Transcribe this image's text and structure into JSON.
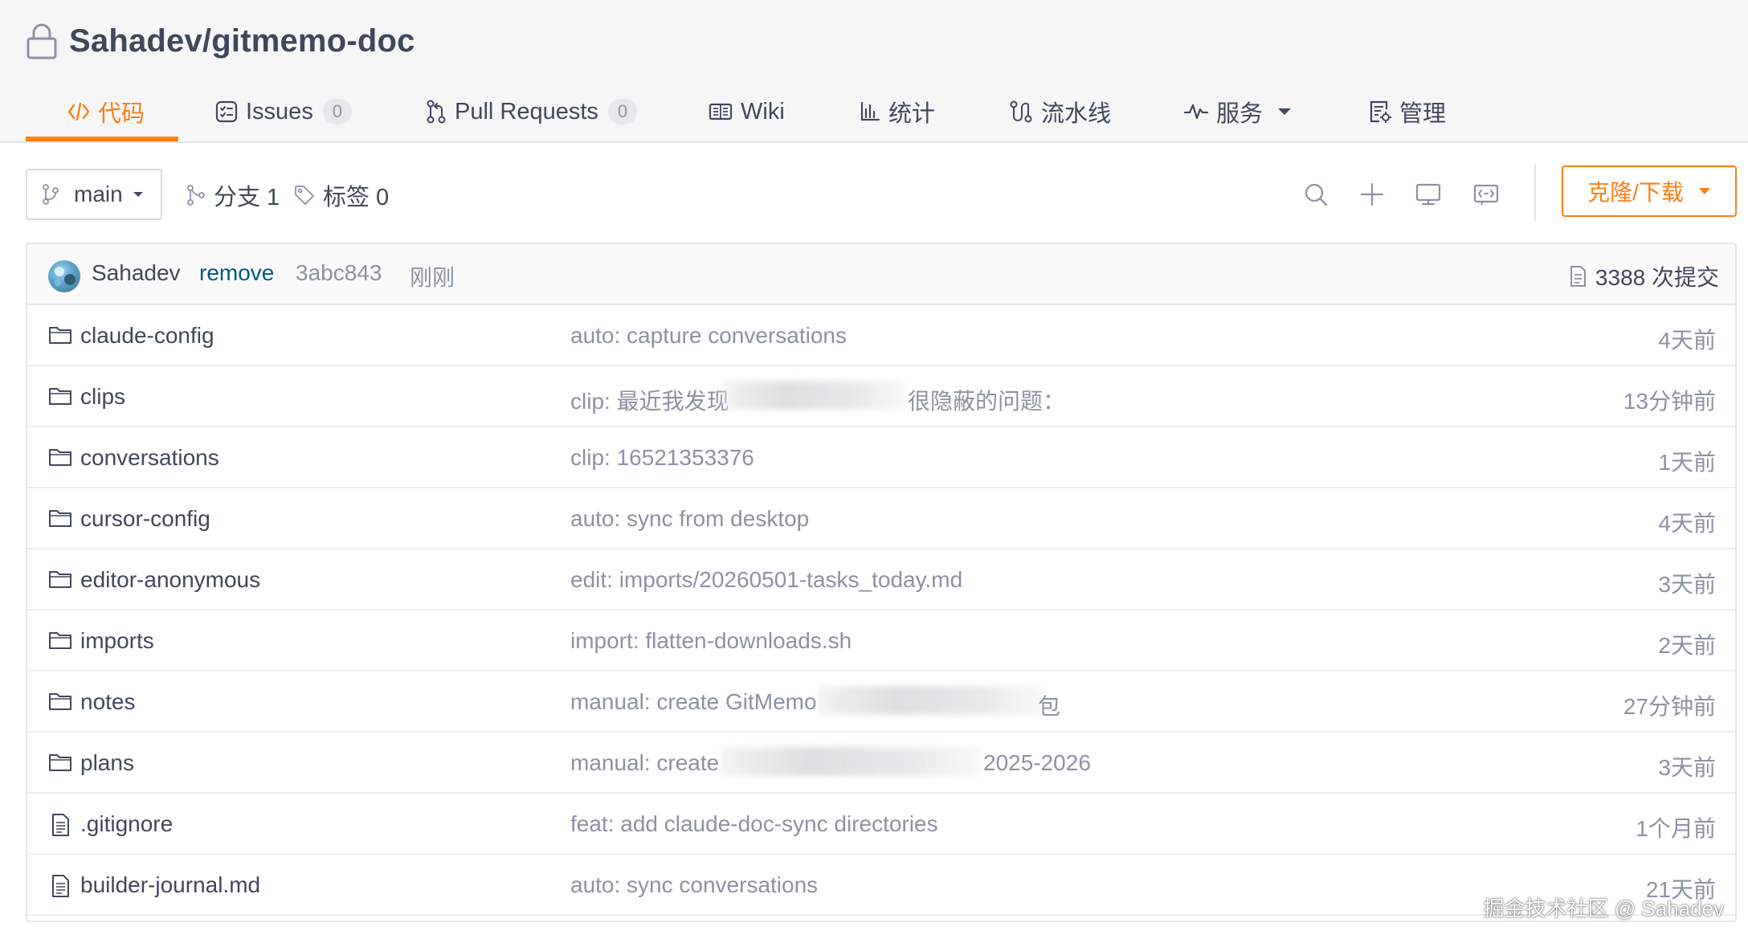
{
  "repo": {
    "full_name": "Sahadev/gitmemo-doc",
    "lock_icon": "lock-icon"
  },
  "tabs": [
    {
      "label": "代码",
      "icon": "code-icon",
      "active": true
    },
    {
      "label": "Issues",
      "icon": "issues-icon",
      "count": "0"
    },
    {
      "label": "Pull Requests",
      "icon": "pull-request-icon",
      "count": "0"
    },
    {
      "label": "Wiki",
      "icon": "book-icon"
    },
    {
      "label": "统计",
      "icon": "stats-icon"
    },
    {
      "label": "流水线",
      "icon": "pipeline-icon"
    },
    {
      "label": "服务",
      "icon": "pulse-icon",
      "dropdown": true
    },
    {
      "label": "管理",
      "icon": "settings-doc-icon"
    }
  ],
  "toolbar": {
    "branch": "main",
    "branches_label": "分支 1",
    "tags_label": "标签 0",
    "clone_label": "克隆/下载"
  },
  "commit": {
    "author": "Sahadev",
    "message": "remove",
    "sha": "3abc843",
    "time": "刚刚",
    "count_label": "3388 次提交"
  },
  "files": [
    {
      "type": "folder",
      "name": "claude-config",
      "message": "auto: capture conversations",
      "time": "4天前"
    },
    {
      "type": "folder",
      "name": "clips",
      "message": "clip: 最近我发现",
      "message_tail": "很隐蔽的问题：",
      "time": "13分钟前"
    },
    {
      "type": "folder",
      "name": "conversations",
      "message": "clip: 16521353376",
      "time": "1天前"
    },
    {
      "type": "folder",
      "name": "cursor-config",
      "message": "auto: sync from desktop",
      "time": "4天前"
    },
    {
      "type": "folder",
      "name": "editor-anonymous",
      "message": "edit: imports/20260501-tasks_today.md",
      "time": "3天前"
    },
    {
      "type": "folder",
      "name": "imports",
      "message": "import: flatten-downloads.sh",
      "time": "2天前"
    },
    {
      "type": "folder",
      "name": "notes",
      "message": "manual: create GitMemo",
      "message_tail": "包",
      "time": "27分钟前"
    },
    {
      "type": "folder",
      "name": "plans",
      "message": "manual: create",
      "message_tail": "2025-2026",
      "time": "3天前"
    },
    {
      "type": "file",
      "name": ".gitignore",
      "message": "feat: add claude-doc-sync directories",
      "time": "1个月前"
    },
    {
      "type": "file",
      "name": "builder-journal.md",
      "message": "auto: sync conversations",
      "time": "21天前"
    }
  ],
  "watermark": "掘金技术社区 @ Sahadev",
  "colors": {
    "accent": "#fa7e14",
    "text": "#40485b",
    "muted": "#8c92a4",
    "link": "#005980"
  }
}
